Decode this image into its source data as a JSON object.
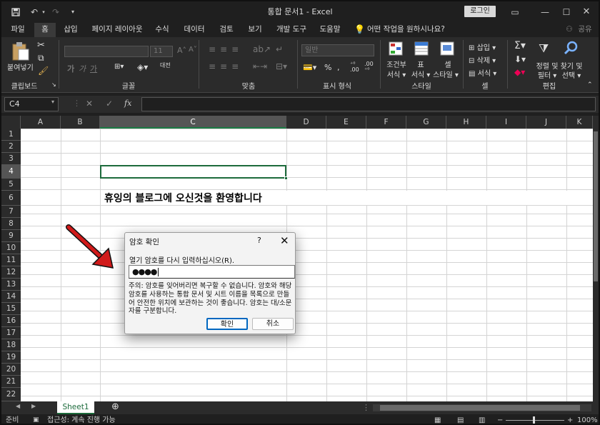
{
  "app": {
    "title": "통합 문서1 - Excel",
    "login": "로그인"
  },
  "tabs": [
    "파일",
    "홈",
    "삽입",
    "페이지 레이아웃",
    "수식",
    "데이터",
    "검토",
    "보기",
    "개발 도구",
    "도움말"
  ],
  "tellme": "어떤 작업을 원하시나요?",
  "share": "공유",
  "ribbon": {
    "paste": "붙여넣기",
    "clipboard": "클립보드",
    "font": "글꼴",
    "font_size": "11",
    "fill": "대전",
    "align": "맞춤",
    "number_format": "일반",
    "number": "표시 형식",
    "cond1": "조건부",
    "cond2": "서식 ▾",
    "table1": "표",
    "table2": "서식 ▾",
    "cell1": "셀",
    "cell2": "스타일 ▾",
    "style": "스타일",
    "insert": "삽입 ▾",
    "delete": "삭제 ▾",
    "format": "서식 ▾",
    "cells": "셀",
    "sort1": "정렬 및",
    "sort2": "필터 ▾",
    "find1": "찾기 및",
    "find2": "선택 ▾",
    "edit": "편집"
  },
  "formula": {
    "namebox": "C4",
    "fx": "fx",
    "value": ""
  },
  "columns": [
    "A",
    "B",
    "C",
    "D",
    "E",
    "F",
    "G",
    "H",
    "I",
    "J",
    "K"
  ],
  "rows": [
    "1",
    "2",
    "3",
    "4",
    "5",
    "6",
    "7",
    "8",
    "9",
    "10",
    "11",
    "12",
    "13",
    "14",
    "15",
    "16",
    "17",
    "18",
    "19",
    "20",
    "21",
    "22"
  ],
  "selected": {
    "col": "C",
    "row": "4"
  },
  "cell_text": "휴잉의 블로그에 오신것을 환영합니다",
  "sheet": {
    "tab": "Sheet1"
  },
  "status": {
    "ready": "준비",
    "accessibility": "접근성: 계속 진행 가능",
    "zoom": "100%"
  },
  "dialog": {
    "title": "암호 확인",
    "help": "?",
    "close": "✕",
    "label": "열기 암호를 다시 입력하십시오(R).",
    "password": "●●●●",
    "warning": "주의: 암호를 잊어버리면 복구할 수 없습니다. 암호와 해당 암호를 사용하는 통합 문서 및 시트 이름을 목록으로 만들어 안전한 위치에 보관하는 것이 좋습니다. 암호는 대/소문자를 구분합니다.",
    "ok": "확인",
    "cancel": "취소"
  },
  "colors": {
    "accent": "#1d6b3c",
    "arrow": "#d11a1a",
    "dialog_focus": "#0067c0"
  }
}
